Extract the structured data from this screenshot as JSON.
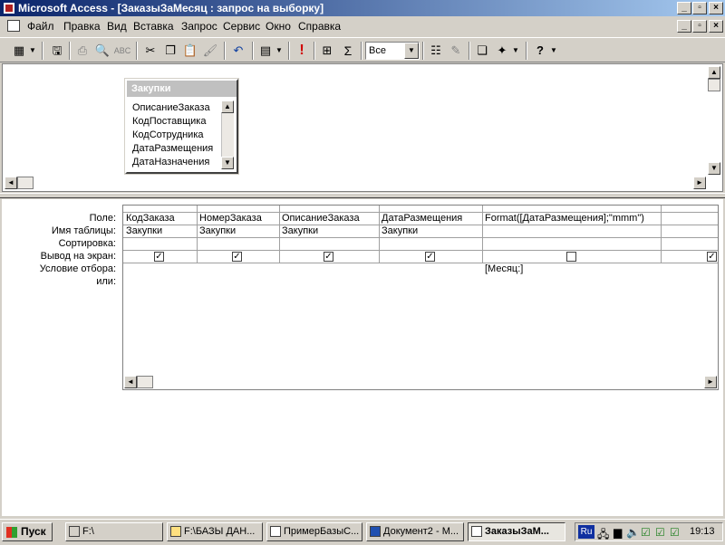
{
  "window": {
    "title": "Microsoft Access - [ЗаказыЗаМесяц : запрос на выборку]"
  },
  "menu": {
    "items": [
      "Файл",
      "Правка",
      "Вид",
      "Вставка",
      "Запрос",
      "Сервис",
      "Окно",
      "Справка"
    ]
  },
  "toolbar": {
    "top_values_combo": "Все"
  },
  "table_box": {
    "title": "Закупки",
    "fields": [
      "ОписаниеЗаказа",
      "КодПоставщика",
      "КодСотрудника",
      "ДатаРазмещения",
      "ДатаНазначения"
    ]
  },
  "grid": {
    "row_labels": [
      "Поле:",
      "Имя таблицы:",
      "Сортировка:",
      "Вывод на экран:",
      "Условие отбора:",
      "или:"
    ],
    "columns": [
      {
        "field": "КодЗаказа",
        "table": "Закупки",
        "sort": "",
        "show": true,
        "criteria": ""
      },
      {
        "field": "НомерЗаказа",
        "table": "Закупки",
        "sort": "",
        "show": true,
        "criteria": ""
      },
      {
        "field": "ОписаниеЗаказа",
        "table": "Закупки",
        "sort": "",
        "show": true,
        "criteria": ""
      },
      {
        "field": "ДатаРазмещения",
        "table": "Закупки",
        "sort": "",
        "show": true,
        "criteria": ""
      },
      {
        "field": "Format([ДатаРазмещения];\"mmm\")",
        "table": "",
        "sort": "",
        "show": false,
        "criteria": "[Месяц:]"
      },
      {
        "field": "",
        "table": "",
        "sort": "",
        "show": true,
        "criteria": ""
      }
    ]
  },
  "taskbar": {
    "start_label": "Пуск",
    "tasks": [
      {
        "label": "F:\\",
        "active": false
      },
      {
        "label": "F:\\БАЗЫ ДАН...",
        "active": false
      },
      {
        "label": "ПримерБазыС...",
        "active": false
      },
      {
        "label": "Документ2 - М...",
        "active": false
      },
      {
        "label": "ЗаказыЗаМ...",
        "active": true
      }
    ],
    "lang": "Ru",
    "clock": "19:13"
  }
}
